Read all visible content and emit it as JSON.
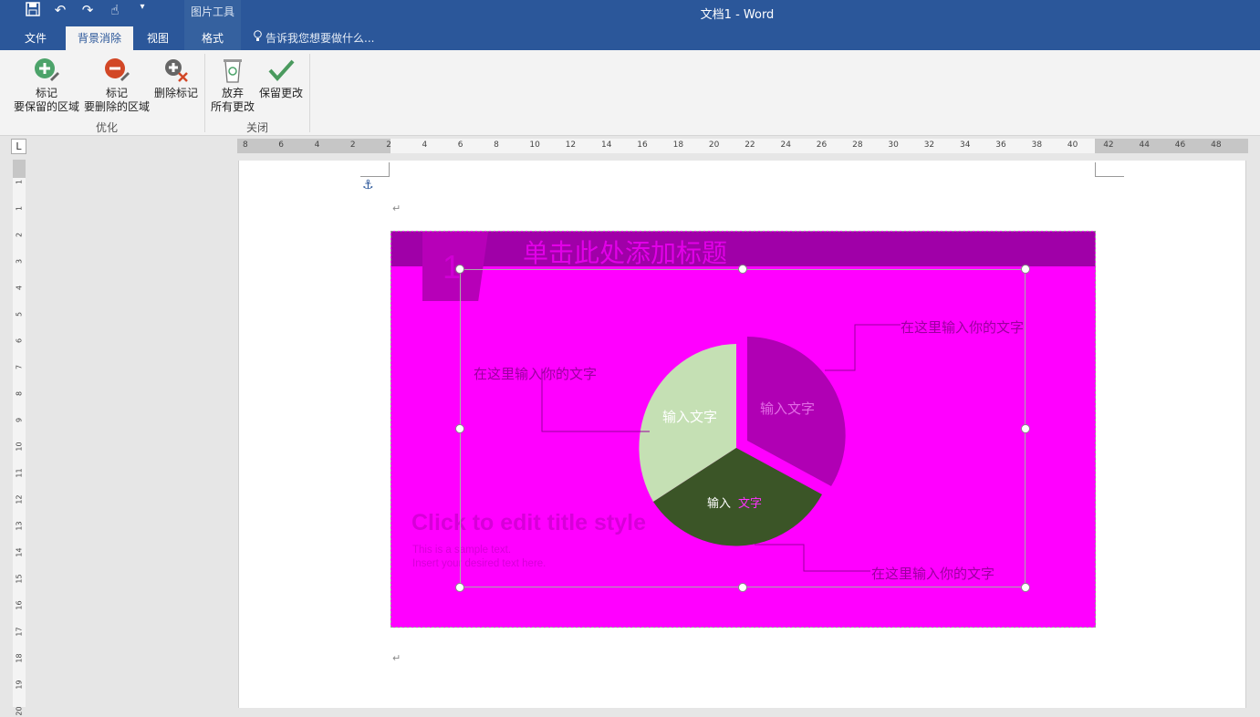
{
  "window": {
    "title": "文档1 - Word",
    "context_tab_group": "图片工具"
  },
  "quick_access": [
    "save-icon",
    "undo-icon",
    "redo-icon",
    "touch-mode-icon",
    "customize-qat-icon"
  ],
  "tabs": [
    {
      "label": "文件"
    },
    {
      "label": "背景消除",
      "active": true
    },
    {
      "label": "视图"
    },
    {
      "label": "格式"
    }
  ],
  "tell_me": "告诉我您想要做什么...",
  "ribbon": {
    "buttons": [
      {
        "line1": "标记",
        "line2": "要保留的区域"
      },
      {
        "line1": "标记",
        "line2": "要删除的区域"
      },
      {
        "line1": "删除标记",
        "line2": ""
      },
      {
        "line1": "放弃",
        "line2": "所有更改"
      },
      {
        "line1": "保留更改",
        "line2": ""
      }
    ],
    "groups": [
      "优化",
      "关闭"
    ]
  },
  "ruler": {
    "h_ticks": [
      "8",
      "6",
      "4",
      "2",
      "2",
      "4",
      "6",
      "8",
      "10",
      "12",
      "14",
      "16",
      "18",
      "20",
      "22",
      "24",
      "26",
      "28",
      "30",
      "32",
      "34",
      "36",
      "38",
      "40",
      "42",
      "44",
      "46",
      "48"
    ],
    "v_ticks": [
      "1",
      "1",
      "2",
      "3",
      "4",
      "5",
      "6",
      "7",
      "8",
      "9",
      "10",
      "11",
      "12",
      "13",
      "14",
      "15",
      "16",
      "17",
      "18",
      "19",
      "20"
    ],
    "tab_selector": "L"
  },
  "document": {
    "para_mark": "↵",
    "anchor_icon": "⚓"
  },
  "slide": {
    "number": "1",
    "title": "单击此处添加标题",
    "callouts": [
      "在这里输入你的文字",
      "在这里输入你的文字",
      "在这里输入你的文字"
    ],
    "pie_labels": [
      "输入文字",
      "输入文字",
      "输入",
      "文字"
    ],
    "big_title": "Click to edit title style",
    "sample_line1": "This is a sample text.",
    "sample_line2": "Insert your desired text here.",
    "colors": {
      "background": "#ff00ff",
      "header": "#a000a8",
      "pie_light": "#c5e0b4",
      "pie_dark": "#3b5527",
      "pie_magenta": "#b000b4"
    }
  }
}
